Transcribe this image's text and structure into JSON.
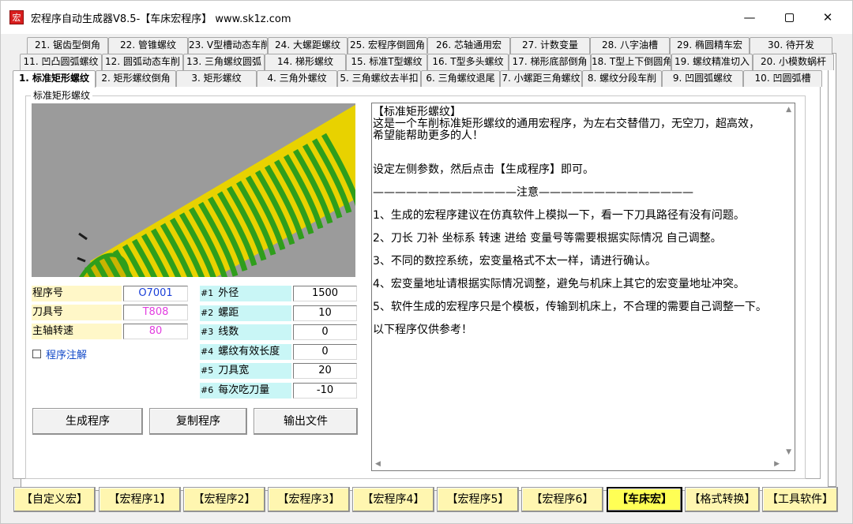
{
  "window": {
    "title": "宏程序自动生成器V8.5-【车床宏程序】   www.sk1z.com",
    "icon_char": "宏",
    "minimize_symbol": "—",
    "close_symbol": "✕"
  },
  "tabs": {
    "row1": [
      "21. 锯齿型倒角",
      "22. 管锥螺纹",
      "23. V型槽动态车削",
      "24. 大螺距螺纹",
      "25. 宏程序倒圆角",
      "26. 芯轴通用宏",
      "27. 计数变量",
      "28. 八字油槽",
      "29. 椭圆精车宏",
      "30. 待开发"
    ],
    "row2": [
      "11. 凹凸圆弧螺纹",
      "12. 圆弧动态车削",
      "13. 三角螺纹圆弧",
      "14. 梯形螺纹",
      "15. 标准T型螺纹",
      "16. T型多头螺纹",
      "17. 梯形底部倒角",
      "18. T型上下倒圆角",
      "19. 螺纹精准切入",
      "20. 小模数蜗杆"
    ],
    "row3": [
      "1. 标准矩形螺纹",
      "2. 矩形螺纹倒角",
      "3. 矩形螺纹",
      "4. 三角外螺纹",
      "5. 三角螺纹去半扣",
      "6. 三角螺纹退尾",
      "7. 小螺距三角螺纹",
      "8. 螺纹分段车削",
      "9. 凹圆弧螺纹",
      "10. 凹圆弧槽"
    ],
    "active": "1. 标准矩形螺纹"
  },
  "group": {
    "label": "标准矩形螺纹"
  },
  "params_left": [
    {
      "label": "程序号",
      "value": "O7001",
      "color": "#1a3fd8"
    },
    {
      "label": "刀具号",
      "value": "T808",
      "color": "#e23fe0"
    },
    {
      "label": "主轴转速",
      "value": "80",
      "color": "#e23fe0"
    }
  ],
  "params_right": [
    {
      "id": "#1",
      "label": "外径",
      "value": "1500"
    },
    {
      "id": "#2",
      "label": "螺距",
      "value": "10"
    },
    {
      "id": "#3",
      "label": "线数",
      "value": "0"
    },
    {
      "id": "#4",
      "label": "螺纹有效长度",
      "value": "0"
    },
    {
      "id": "#5",
      "label": "刀具宽",
      "value": "20"
    },
    {
      "id": "#6",
      "label": "每次吃刀量",
      "value": "-10"
    }
  ],
  "checkbox": {
    "label": "程序注解"
  },
  "buttons": {
    "generate": "生成程序",
    "copy": "复制程序",
    "export": "输出文件"
  },
  "description": {
    "lines": [
      "【标准矩形螺纹】",
      "这是一个车削标准矩形螺纹的通用宏程序，为左右交替借刀，无空刀，超高效，",
      "希望能帮助更多的人！",
      "",
      "设定左侧参数，然后点击【生成程序】即可。",
      "—————————————注意——————————————",
      "1、生成的宏程序建议在仿真软件上模拟一下，看一下刀具路径有没有问题。",
      "2、刀长 刀补 坐标系 转速 进给 变量号等需要根据实际情况 自己调整。",
      "3、不同的数控系统，宏变量格式不太一样，请进行确认。",
      "4、宏变量地址请根据实际情况调整，避免与机床上其它的宏变量地址冲突。",
      "5、软件生成的宏程序只是个模板，传输到机床上，不合理的需要自己调整一下。",
      "以下程序仅供参考！"
    ]
  },
  "scroll": {
    "up": "▲",
    "down": "▼",
    "left": "◀",
    "right": "▶"
  },
  "bottom_buttons": [
    "【自定义宏】",
    "【宏程序1】",
    "【宏程序2】",
    "【宏程序3】",
    "【宏程序4】",
    "【宏程序5】",
    "【宏程序6】",
    "【车床宏】",
    "【格式转换】",
    "【工具软件】"
  ],
  "bottom_active": "【车床宏】",
  "colors": {
    "cylinder_yellow": "#e8d200",
    "thread_green": "#2f9e1c",
    "preview_bg": "#9b9b9b"
  }
}
